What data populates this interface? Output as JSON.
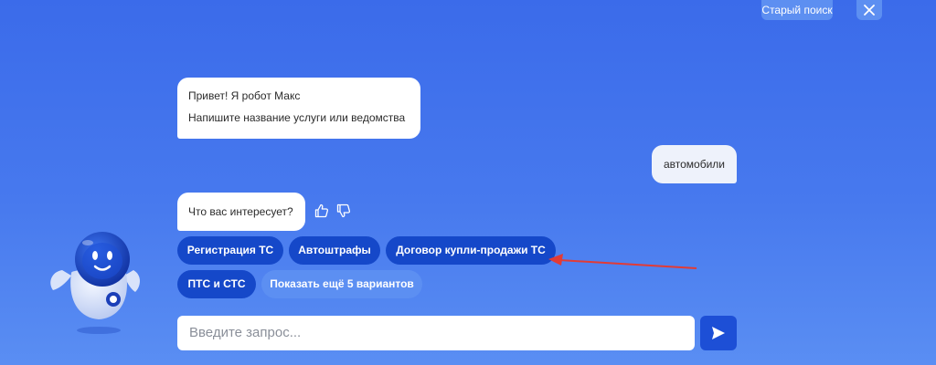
{
  "header": {
    "old_search_label": "Старый поиск",
    "close_icon": "close-icon"
  },
  "chat": {
    "bot_greeting": [
      "Привет! Я робот Макс",
      "Напишите название услуги или ведомства"
    ],
    "user_message": "автомобили",
    "bot_question": "Что вас интересует?",
    "feedback_icons": [
      "thumbs-up-icon",
      "thumbs-down-icon"
    ],
    "suggestions": [
      "Регистрация ТС",
      "Автоштрафы",
      "Договор купли-продажи ТС",
      "ПТС и СТС",
      "Показать ещё 5 вариантов"
    ]
  },
  "input": {
    "placeholder": "Введите запрос..."
  },
  "send_icon": "send-icon",
  "colors": {
    "background": "#4779ee",
    "chip": "#1548c9",
    "chip_more": "#5c8ff2",
    "send_button": "#1d4fd6",
    "annotation_arrow": "#e23b35"
  }
}
